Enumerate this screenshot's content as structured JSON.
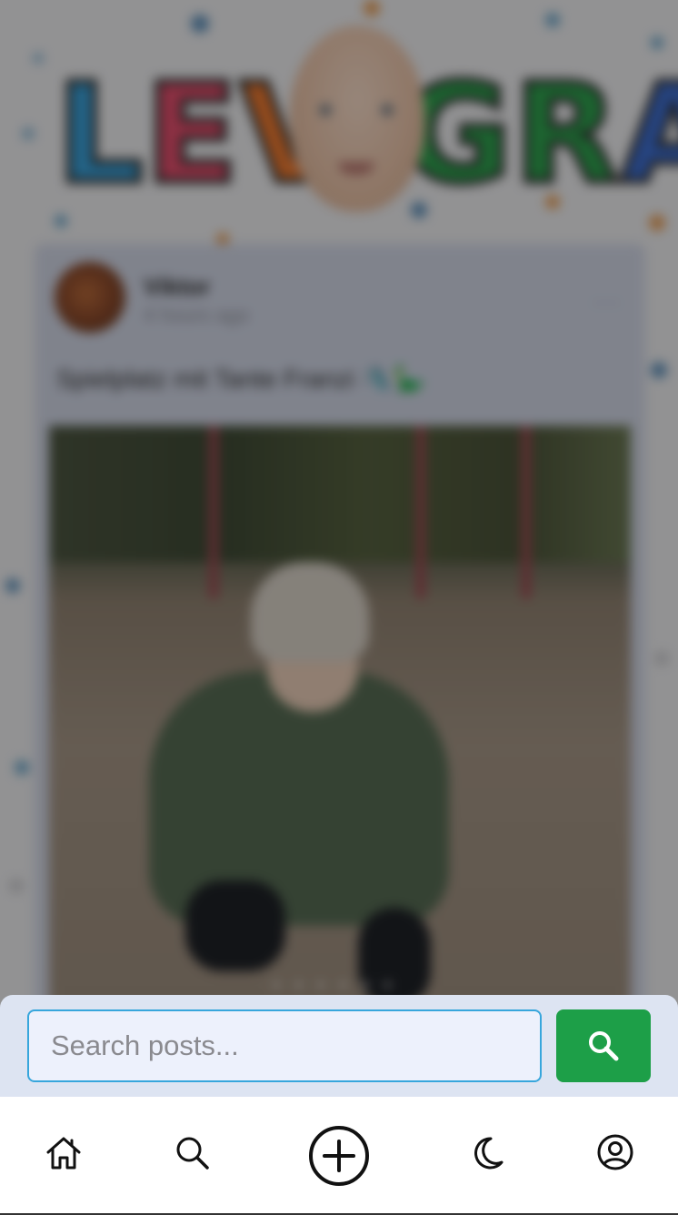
{
  "feed": {
    "logo_text": "LEVIGRAM",
    "post": {
      "author": "Viktor",
      "time": "4 hours ago",
      "caption": "Spielplatz mit Tante Franzi 🛝🦕",
      "more_label": "···",
      "carousel_dots": "●●●●●●"
    }
  },
  "search": {
    "placeholder": "Search posts...",
    "value": "",
    "button_icon": "search-icon",
    "button_color": "#1d9f48",
    "input_border_color": "#37a6dc"
  },
  "nav": {
    "items": [
      {
        "icon": "home-icon"
      },
      {
        "icon": "search-icon"
      },
      {
        "icon": "add-circle-icon"
      },
      {
        "icon": "moon-icon"
      },
      {
        "icon": "profile-icon"
      }
    ]
  }
}
